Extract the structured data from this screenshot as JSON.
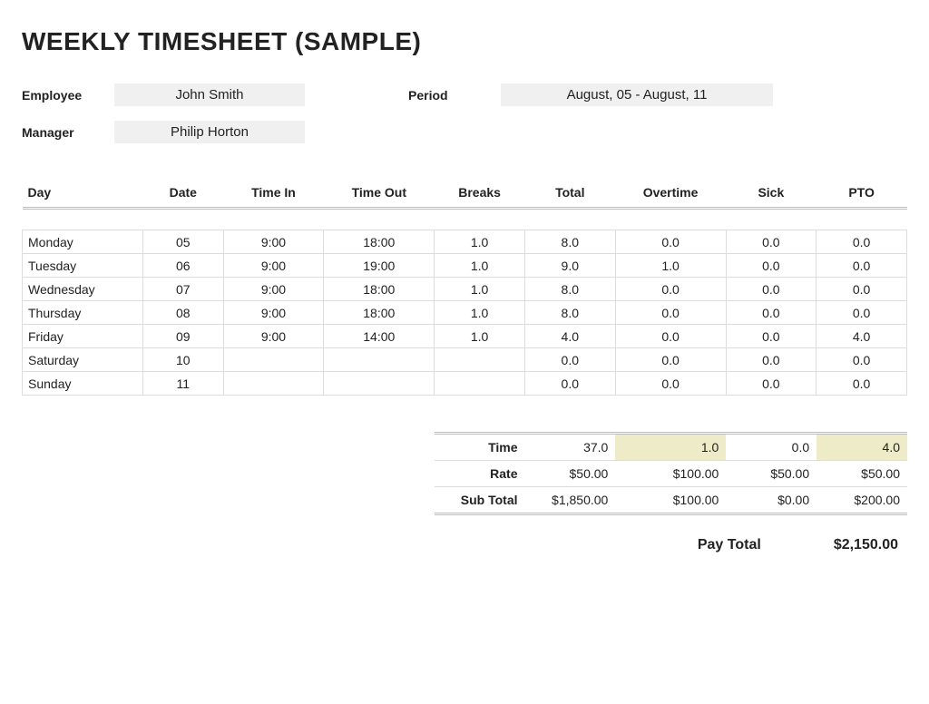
{
  "title": "WEEKLY TIMESHEET (SAMPLE)",
  "meta": {
    "employee_label": "Employee",
    "employee_value": "John Smith",
    "period_label": "Period",
    "period_value": "August, 05 - August, 11",
    "manager_label": "Manager",
    "manager_value": "Philip Horton"
  },
  "columns": {
    "day": "Day",
    "date": "Date",
    "time_in": "Time In",
    "time_out": "Time Out",
    "breaks": "Breaks",
    "total": "Total",
    "overtime": "Overtime",
    "sick": "Sick",
    "pto": "PTO"
  },
  "rows": [
    {
      "day": "Monday",
      "date": "05",
      "in": "9:00",
      "out": "18:00",
      "breaks": "1.0",
      "total": "8.0",
      "ot": "0.0",
      "sick": "0.0",
      "pto": "0.0"
    },
    {
      "day": "Tuesday",
      "date": "06",
      "in": "9:00",
      "out": "19:00",
      "breaks": "1.0",
      "total": "9.0",
      "ot": "1.0",
      "sick": "0.0",
      "pto": "0.0"
    },
    {
      "day": "Wednesday",
      "date": "07",
      "in": "9:00",
      "out": "18:00",
      "breaks": "1.0",
      "total": "8.0",
      "ot": "0.0",
      "sick": "0.0",
      "pto": "0.0"
    },
    {
      "day": "Thursday",
      "date": "08",
      "in": "9:00",
      "out": "18:00",
      "breaks": "1.0",
      "total": "8.0",
      "ot": "0.0",
      "sick": "0.0",
      "pto": "0.0"
    },
    {
      "day": "Friday",
      "date": "09",
      "in": "9:00",
      "out": "14:00",
      "breaks": "1.0",
      "total": "4.0",
      "ot": "0.0",
      "sick": "0.0",
      "pto": "4.0"
    },
    {
      "day": "Saturday",
      "date": "10",
      "in": "",
      "out": "",
      "breaks": "",
      "total": "0.0",
      "ot": "0.0",
      "sick": "0.0",
      "pto": "0.0"
    },
    {
      "day": "Sunday",
      "date": "11",
      "in": "",
      "out": "",
      "breaks": "",
      "total": "0.0",
      "ot": "0.0",
      "sick": "0.0",
      "pto": "0.0"
    }
  ],
  "summary": {
    "time_label": "Time",
    "rate_label": "Rate",
    "subtotal_label": "Sub Total",
    "time": {
      "total": "37.0",
      "ot": "1.0",
      "sick": "0.0",
      "pto": "4.0"
    },
    "rate": {
      "total": "$50.00",
      "ot": "$100.00",
      "sick": "$50.00",
      "pto": "$50.00"
    },
    "subtotal": {
      "total": "$1,850.00",
      "ot": "$100.00",
      "sick": "$0.00",
      "pto": "$200.00"
    }
  },
  "paytotal": {
    "label": "Pay Total",
    "value": "$2,150.00"
  }
}
